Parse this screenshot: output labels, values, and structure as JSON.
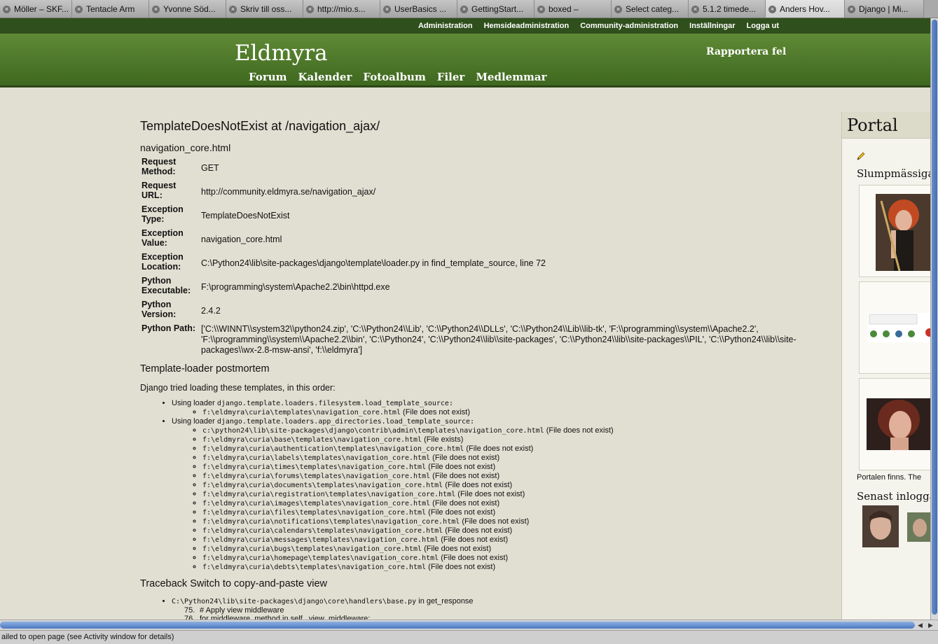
{
  "browser": {
    "tabs": [
      {
        "title": "Möller – SKF..."
      },
      {
        "title": "Tentacle Arm"
      },
      {
        "title": "Yvonne Söd..."
      },
      {
        "title": "Skriv till oss..."
      },
      {
        "title": "http://mio.s..."
      },
      {
        "title": "UserBasics ..."
      },
      {
        "title": "GettingStart..."
      },
      {
        "title": "boxed –"
      },
      {
        "title": "Select categ..."
      },
      {
        "title": "5.1.2 timede..."
      },
      {
        "title": "Anders Hov..."
      },
      {
        "title": "Django | Mi..."
      }
    ],
    "status": "ailed to open page (see Activity window for details)"
  },
  "site": {
    "admin_links": [
      "Administration",
      "Hemsideadministration",
      "Community-administration",
      "Inställningar",
      "Logga ut"
    ],
    "title": "Eldmyra",
    "report_link": "Rapportera fel",
    "nav": [
      "Forum",
      "Kalender",
      "Fotoalbum",
      "Filer",
      "Medlemmar"
    ]
  },
  "error": {
    "title": "TemplateDoesNotExist at /navigation_ajax/",
    "subtitle": "navigation_core.html",
    "meta": [
      {
        "label": "Request Method:",
        "value": "GET"
      },
      {
        "label": "Request URL:",
        "value": "http://community.eldmyra.se/navigation_ajax/"
      },
      {
        "label": "Exception Type:",
        "value": "TemplateDoesNotExist"
      },
      {
        "label": "Exception Value:",
        "value": "navigation_core.html"
      },
      {
        "label": "Exception Location:",
        "value": "C:\\Python24\\lib\\site-packages\\django\\template\\loader.py in find_template_source, line 72"
      },
      {
        "label": "Python Executable:",
        "value": "F:\\programming\\system\\Apache2.2\\bin\\httpd.exe"
      },
      {
        "label": "Python Version:",
        "value": "2.4.2"
      },
      {
        "label": "Python Path:",
        "value": "['C:\\\\WINNT\\\\system32\\\\python24.zip', 'C:\\\\Python24\\\\Lib', 'C:\\\\Python24\\\\DLLs', 'C:\\\\Python24\\\\Lib\\\\lib-tk', 'F:\\\\programming\\\\system\\\\Apache2.2', 'F:\\\\programming\\\\system\\\\Apache2.2\\\\bin', 'C:\\\\Python24', 'C:\\\\Python24\\\\lib\\\\site-packages', 'C:\\\\Python24\\\\lib\\\\site-packages\\\\PIL', 'C:\\\\Python24\\\\lib\\\\site-packages\\\\wx-2.8-msw-ansi', 'f:\\\\eldmyra']"
      }
    ],
    "postmortem": {
      "heading": "Template-loader postmortem",
      "intro": "Django tried loading these templates, in this order:",
      "using_prefix": "Using loader",
      "loaders": [
        {
          "name": "django.template.loaders.filesystem.load_template_source:",
          "entries": [
            {
              "path": "f:\\eldmyra\\curia\\templates\\navigation_core.html",
              "status": "(File does not exist)"
            }
          ]
        },
        {
          "name": "django.template.loaders.app_directories.load_template_source:",
          "entries": [
            {
              "path": "c:\\python24\\lib\\site-packages\\django\\contrib\\admin\\templates\\navigation_core.html",
              "status": "(File does not exist)"
            },
            {
              "path": "f:\\eldmyra\\curia\\base\\templates\\navigation_core.html",
              "status": "(File exists)"
            },
            {
              "path": "f:\\eldmyra\\curia\\authentication\\templates\\navigation_core.html",
              "status": "(File does not exist)"
            },
            {
              "path": "f:\\eldmyra\\curia\\labels\\templates\\navigation_core.html",
              "status": "(File does not exist)"
            },
            {
              "path": "f:\\eldmyra\\curia\\times\\templates\\navigation_core.html",
              "status": "(File does not exist)"
            },
            {
              "path": "f:\\eldmyra\\curia\\forums\\templates\\navigation_core.html",
              "status": "(File does not exist)"
            },
            {
              "path": "f:\\eldmyra\\curia\\documents\\templates\\navigation_core.html",
              "status": "(File does not exist)"
            },
            {
              "path": "f:\\eldmyra\\curia\\registration\\templates\\navigation_core.html",
              "status": "(File does not exist)"
            },
            {
              "path": "f:\\eldmyra\\curia\\images\\templates\\navigation_core.html",
              "status": "(File does not exist)"
            },
            {
              "path": "f:\\eldmyra\\curia\\files\\templates\\navigation_core.html",
              "status": "(File does not exist)"
            },
            {
              "path": "f:\\eldmyra\\curia\\notifications\\templates\\navigation_core.html",
              "status": "(File does not exist)"
            },
            {
              "path": "f:\\eldmyra\\curia\\calendars\\templates\\navigation_core.html",
              "status": "(File does not exist)"
            },
            {
              "path": "f:\\eldmyra\\curia\\messages\\templates\\navigation_core.html",
              "status": "(File does not exist)"
            },
            {
              "path": "f:\\eldmyra\\curia\\bugs\\templates\\navigation_core.html",
              "status": "(File does not exist)"
            },
            {
              "path": "f:\\eldmyra\\curia\\homepage\\templates\\navigation_core.html",
              "status": "(File does not exist)"
            },
            {
              "path": "f:\\eldmyra\\curia\\debts\\templates\\navigation_core.html",
              "status": "(File does not exist)"
            }
          ]
        }
      ]
    },
    "traceback": {
      "heading": "Traceback",
      "switch_link": "Switch to copy-and-paste view",
      "frame_file": "C:\\Python24\\lib\\site-packages\\django\\core\\handlers\\base.py",
      "frame_in": "in",
      "frame_func": "get_response",
      "lines": [
        {
          "no": "75.",
          "code": "# Apply view middleware"
        },
        {
          "no": "76.",
          "code": "for middleware_method in self._view_middleware:"
        }
      ]
    }
  },
  "sidebar": {
    "heading": "Portal",
    "pencil_icon": "pencil-icon",
    "random_title": "Slumpmässiga b",
    "text": "Portalen finns. The",
    "latest_title": "Senast inloggad"
  },
  "colors": {
    "header_green": "#4f7a2b",
    "topbar_green": "#2f4f1c",
    "page_bg": "#e1dfd2"
  }
}
